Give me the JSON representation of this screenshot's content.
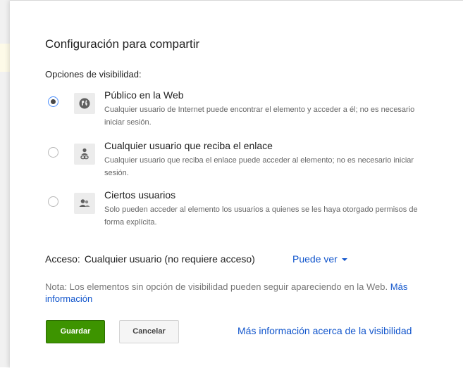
{
  "dialog": {
    "title": "Configuración para compartir",
    "visibility_label": "Opciones de visibilidad:",
    "options": [
      {
        "title": "Público en la Web",
        "description": "Cualquier usuario de Internet puede encontrar el elemento y acceder a él; no es necesario iniciar sesión.",
        "icon": "globe-icon",
        "selected": true
      },
      {
        "title": "Cualquier usuario que reciba el enlace",
        "description": "Cualquier usuario que reciba el enlace puede acceder al elemento; no es necesario iniciar sesión.",
        "icon": "link-person-icon",
        "selected": false
      },
      {
        "title": "Ciertos usuarios",
        "description": "Solo pueden acceder al elemento los usuarios a quienes se les haya otorgado permisos de forma explícita.",
        "icon": "people-icon",
        "selected": false
      }
    ],
    "access": {
      "label": "Acceso:",
      "value": "Cualquier usuario (no requiere acceso)",
      "permission": "Puede ver"
    },
    "note": {
      "text": "Nota: Los elementos sin opción de visibilidad pueden seguir apareciendo en la Web.",
      "link": "Más información"
    },
    "buttons": {
      "save": "Guardar",
      "cancel": "Cancelar"
    },
    "more_info_link": "Más información acerca de la visibilidad"
  },
  "colors": {
    "primary_button": "#3d9400",
    "link": "#1155cc",
    "radio_selected_ring": "#4d90fe"
  }
}
